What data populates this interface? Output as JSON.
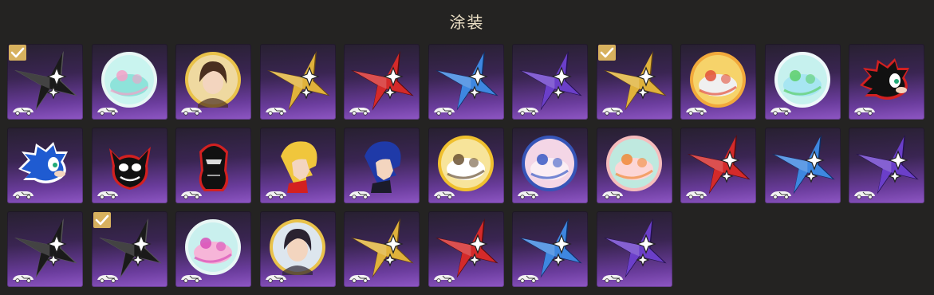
{
  "panel": {
    "title": "涂装"
  },
  "colors": {
    "background": "#242322",
    "check": "#d7b15e",
    "tile_dark": "#272030",
    "tile_light": "#8e56c4"
  },
  "skins": [
    {
      "name": "black-star-icon",
      "kind": "star",
      "color": "#1a1a1a",
      "outline": "#555",
      "equipped": true
    },
    {
      "name": "holo-orb-icon",
      "kind": "orb",
      "c1": "#c9f4ef",
      "c2": "#8ee3da",
      "accent": "#f4a0c8",
      "ring": "#e8f7f5",
      "equipped": false
    },
    {
      "name": "brown-hair-portrait-icon",
      "kind": "portrait",
      "bg": "#efd9a0",
      "ring": "#e9c24a",
      "hair": "#4a2e1f",
      "skin": "#f3d5bf",
      "equipped": false
    },
    {
      "name": "gold-star-icon",
      "kind": "star",
      "color": "#e0b23b",
      "outline": "#6b4a10",
      "equipped": false
    },
    {
      "name": "red-star-icon",
      "kind": "star",
      "color": "#d42a2a",
      "outline": "#5a0b0b",
      "equipped": false
    },
    {
      "name": "blue-star-icon",
      "kind": "star",
      "color": "#3e87e0",
      "outline": "#0d2f66",
      "equipped": false
    },
    {
      "name": "purple-star-icon",
      "kind": "star",
      "color": "#6b3fc9",
      "outline": "#241150",
      "equipped": false
    },
    {
      "name": "gold-star-icon",
      "kind": "star",
      "color": "#e0b23b",
      "outline": "#6b4a10",
      "equipped": true
    },
    {
      "name": "cartoon-crew-badge-icon",
      "kind": "orb",
      "c1": "#f6d36a",
      "c2": "#f0f0f0",
      "accent": "#e2503a",
      "ring": "#f2a93b",
      "equipped": false
    },
    {
      "name": "robot-orb-icon",
      "kind": "orb",
      "c1": "#c6f1ee",
      "c2": "#a7e6f2",
      "accent": "#5ccf6a",
      "ring": "#eef8fa",
      "equipped": false
    },
    {
      "name": "shadow-hedgehog-icon",
      "kind": "hedgehog",
      "color": "#111",
      "accent": "#d32020",
      "equipped": false
    },
    {
      "name": "blue-hedgehog-icon",
      "kind": "hedgehog",
      "color": "#1f5bd1",
      "accent": "#ffffff",
      "equipped": false
    },
    {
      "name": "black-cat-mask-icon",
      "kind": "cat",
      "color": "#111",
      "accent": "#d32020",
      "equipped": false
    },
    {
      "name": "masked-hero-icon",
      "kind": "figure",
      "color": "#111",
      "accent": "#d32020",
      "equipped": false
    },
    {
      "name": "blonde-hero-profile-icon",
      "kind": "profile",
      "hair": "#f0c63c",
      "skin": "#f3d5bf",
      "accent": "#d32020",
      "equipped": false
    },
    {
      "name": "blue-hair-profile-icon",
      "kind": "profile",
      "hair": "#1f3aa8",
      "skin": "#f3d5bf",
      "accent": "#1b1b2a",
      "equipped": false
    },
    {
      "name": "cow-mascot-orb-icon",
      "kind": "orb",
      "c1": "#f7e49a",
      "c2": "#ffffff",
      "accent": "#6b5233",
      "ring": "#f0c02e",
      "equipped": false
    },
    {
      "name": "pink-hair-girl-orb-icon",
      "kind": "orb",
      "c1": "#f4d6e6",
      "c2": "#fbeef4",
      "accent": "#3a5bc4",
      "ring": "#3655b8",
      "equipped": false
    },
    {
      "name": "party-animals-orb-icon",
      "kind": "orb",
      "c1": "#bfe9df",
      "c2": "#fcd6d6",
      "accent": "#f08a3a",
      "ring": "#f6bcbc",
      "equipped": false
    },
    {
      "name": "red-star-icon",
      "kind": "star",
      "color": "#d42a2a",
      "outline": "#5a0b0b",
      "equipped": false
    },
    {
      "name": "blue-star-icon",
      "kind": "star",
      "color": "#3e87e0",
      "outline": "#0d2f66",
      "equipped": false
    },
    {
      "name": "purple-star-icon",
      "kind": "star",
      "color": "#6b3fc9",
      "outline": "#241150",
      "equipped": false
    },
    {
      "name": "black-star-icon",
      "kind": "star",
      "color": "#1a1a1a",
      "outline": "#555",
      "equipped": false
    },
    {
      "name": "black-star-icon",
      "kind": "star",
      "color": "#1a1a1a",
      "outline": "#555",
      "equipped": true
    },
    {
      "name": "pink-cat-orb-icon",
      "kind": "orb",
      "c1": "#c9f0ee",
      "c2": "#f6b5d8",
      "accent": "#d84fb8",
      "ring": "#e8f7f5",
      "equipped": false
    },
    {
      "name": "dark-hair-portrait-icon",
      "kind": "portrait",
      "bg": "#dde6ee",
      "ring": "#e9c24a",
      "hair": "#2a2230",
      "skin": "#f3d5bf",
      "equipped": false
    },
    {
      "name": "gold-star-icon",
      "kind": "star",
      "color": "#e0b23b",
      "outline": "#6b4a10",
      "equipped": false
    },
    {
      "name": "red-star-icon",
      "kind": "star",
      "color": "#d42a2a",
      "outline": "#5a0b0b",
      "equipped": false
    },
    {
      "name": "blue-star-icon",
      "kind": "star",
      "color": "#3e87e0",
      "outline": "#0d2f66",
      "equipped": false
    },
    {
      "name": "purple-star-icon",
      "kind": "star",
      "color": "#6b3fc9",
      "outline": "#241150",
      "equipped": false
    }
  ]
}
